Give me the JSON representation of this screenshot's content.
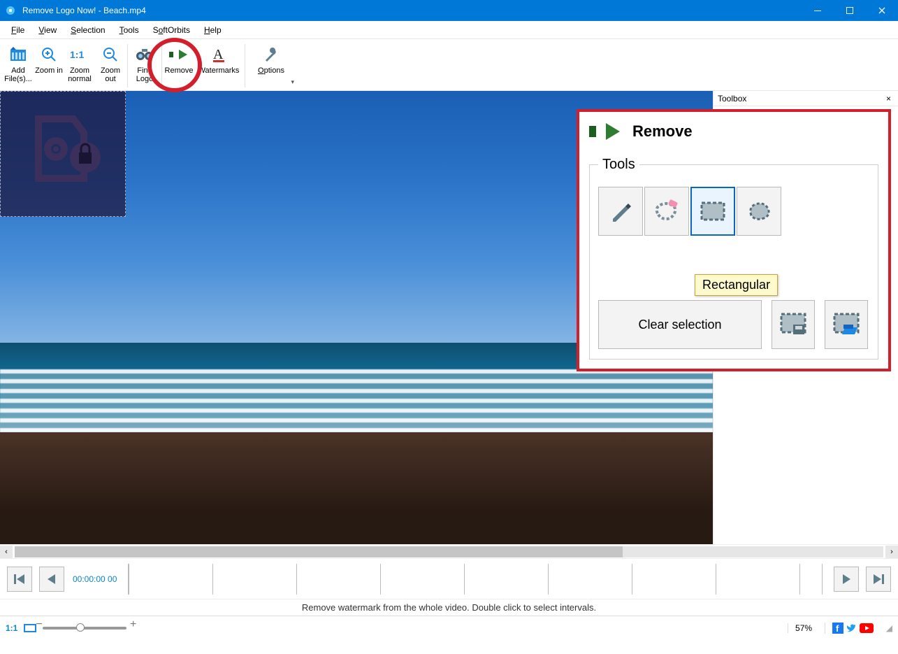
{
  "title": "Remove Logo Now! - Beach.mp4",
  "menu": {
    "file": "File",
    "view": "View",
    "selection": "Selection",
    "tools": "Tools",
    "softorbits": "SoftOrbits",
    "help": "Help"
  },
  "toolbar": {
    "add_files": "Add File(s)...",
    "zoom_in": "Zoom in",
    "zoom_normal": "Zoom normal",
    "zoom_out": "Zoom out",
    "find_logo": "Find Logo",
    "remove": "Remove",
    "watermarks": "Watermarks",
    "options": "Options"
  },
  "side": {
    "title": "Toolbox"
  },
  "panel": {
    "heading": "Remove",
    "fieldset": "Tools",
    "tooltip": "Rectangular",
    "clear": "Clear selection"
  },
  "playback": {
    "timecode": "00:00:00 00"
  },
  "hint": "Remove watermark from the whole video. Double click to select intervals.",
  "status": {
    "ratio": "1:1",
    "zoom": "57%"
  }
}
